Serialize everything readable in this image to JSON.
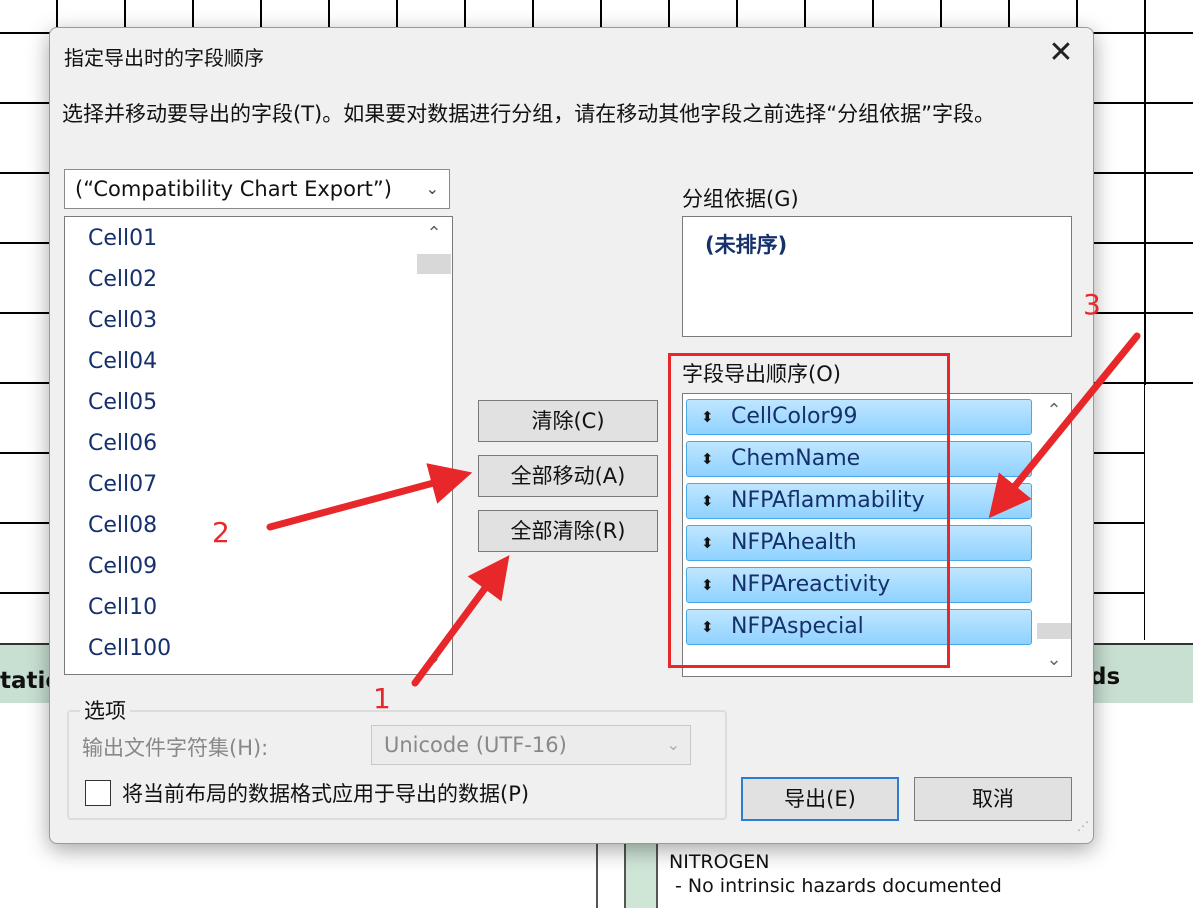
{
  "background": {
    "header_left": "tatio",
    "header_right": "ds",
    "detail_text": "NITROGEN\n - No intrinsic hazards documented"
  },
  "dialog": {
    "title": "指定导出时的字段顺序",
    "close_label": "✕",
    "instruction": "选择并移动要导出的字段(T)。如果要对数据进行分组，请在移动其他字段之前选择“分组依据”字段。",
    "source": {
      "value": "(“Compatibility Chart Export”)",
      "arrow": "⌄"
    },
    "fields": [
      "Cell01",
      "Cell02",
      "Cell03",
      "Cell04",
      "Cell05",
      "Cell06",
      "Cell07",
      "Cell08",
      "Cell09",
      "Cell10",
      "Cell100"
    ],
    "buttons": {
      "clear": "清除(C)",
      "move_all": "全部移动(A)",
      "clear_all": "全部清除(R)",
      "export": "导出(E)",
      "cancel": "取消"
    },
    "group_by": {
      "label": "分组依据(G)",
      "value": "(未排序)"
    },
    "export_order": {
      "label": "字段导出顺序(O)",
      "items": [
        "CellColor99",
        "ChemName",
        "NFPAflammability",
        "NFPAhealth",
        "NFPAreactivity",
        "NFPAspecial"
      ]
    },
    "options": {
      "label": "选项",
      "charset_label": "输出文件字符集(H):",
      "charset_value": "Unicode (UTF-16)",
      "apply_format_label": "将当前布局的数据格式应用于导出的数据(P)",
      "apply_format_checked": false
    }
  },
  "annotations": {
    "numbers": [
      "1",
      "2",
      "3"
    ],
    "color": "#e8272a"
  }
}
